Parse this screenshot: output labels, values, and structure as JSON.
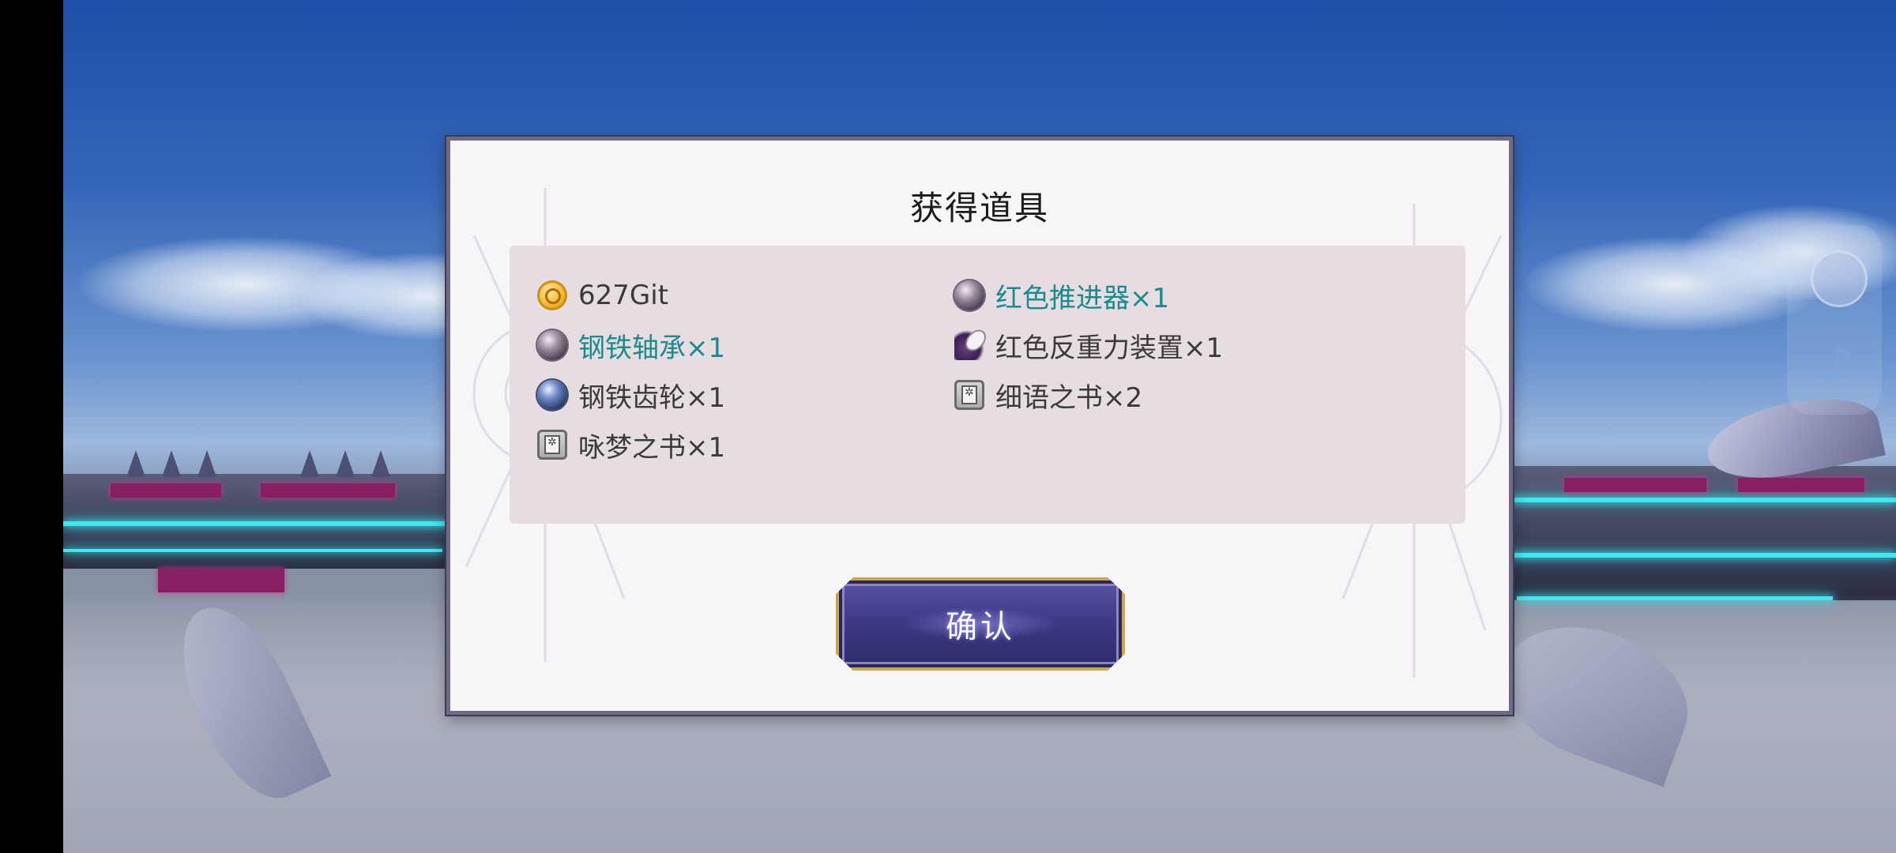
{
  "dialog": {
    "title": "获得道具",
    "confirm_label": "确认"
  },
  "items": [
    {
      "label": "627Git",
      "icon": "coin-icon",
      "highlight": false
    },
    {
      "label": "红色推进器×1",
      "icon": "orb-purple-icon",
      "highlight": true
    },
    {
      "label": "钢铁轴承×1",
      "icon": "orb-purple-icon",
      "highlight": true
    },
    {
      "label": "红色反重力装置×1",
      "icon": "device-icon",
      "highlight": false
    },
    {
      "label": "钢铁齿轮×1",
      "icon": "orb-blue-icon",
      "highlight": false
    },
    {
      "label": "细语之书×2",
      "icon": "book-icon",
      "highlight": false
    },
    {
      "label": "咏梦之书×1",
      "icon": "book-icon",
      "highlight": false
    }
  ],
  "colors": {
    "highlight_text": "#1a8a8a",
    "normal_text": "#3a3a3a",
    "panel_bg": "#e6dde3",
    "button_border": "#c9a650"
  },
  "side_widget": {
    "avatar_icon": "avatar",
    "music_icon": "music-note-icon",
    "music_glyph": "♪"
  }
}
